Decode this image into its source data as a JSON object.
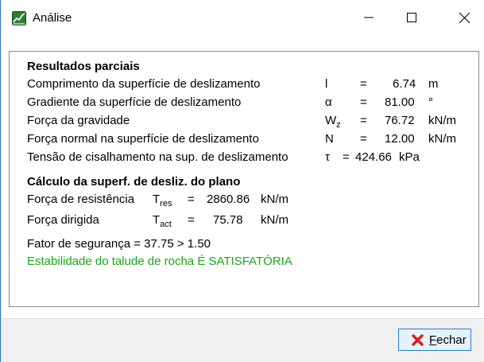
{
  "window": {
    "title": "Análise"
  },
  "results": {
    "heading": "Resultados parciais",
    "rows": [
      {
        "label": "Comprimento da superfície de deslizamento",
        "symbol": "l",
        "sub": "",
        "eq": "=",
        "value": "6.74",
        "unit": "m"
      },
      {
        "label": "Gradiente da superfície de deslizamento",
        "symbol": "α",
        "sub": "",
        "eq": "=",
        "value": "81.00",
        "unit": "°"
      },
      {
        "label": "Força da gravidade",
        "symbol": "W",
        "sub": "z",
        "eq": "=",
        "value": "76.72",
        "unit": "kN/m"
      },
      {
        "label": "Força normal na superfície de deslizamento",
        "symbol": "N",
        "sub": "",
        "eq": "=",
        "value": "12.00",
        "unit": "kN/m"
      },
      {
        "label": "Tensão de cisalhamento na sup. de deslizamento",
        "symbol": "τ",
        "sub": "",
        "eq": "=",
        "value": "424.66",
        "unit": "kPa"
      }
    ]
  },
  "plane": {
    "heading": "Cálculo da superf. de desliz. do plano",
    "resisting": {
      "label": "Força de resistência",
      "symbol": "T",
      "sub": "res",
      "eq": "=",
      "value": "2860.86",
      "unit": "kN/m"
    },
    "driving": {
      "label": "Força dirigida",
      "symbol": "T",
      "sub": "act",
      "eq": "=",
      "value": "75.78",
      "unit": "kN/m"
    }
  },
  "safety": {
    "factor_text": "Fator de segurança = 37.75 > 1.50",
    "status_text": "Estabilidade do talude de rocha É SATISFATÓRIA",
    "status_color": "#19a719"
  },
  "footer": {
    "close_label_first": "F",
    "close_label_rest": "echar"
  }
}
